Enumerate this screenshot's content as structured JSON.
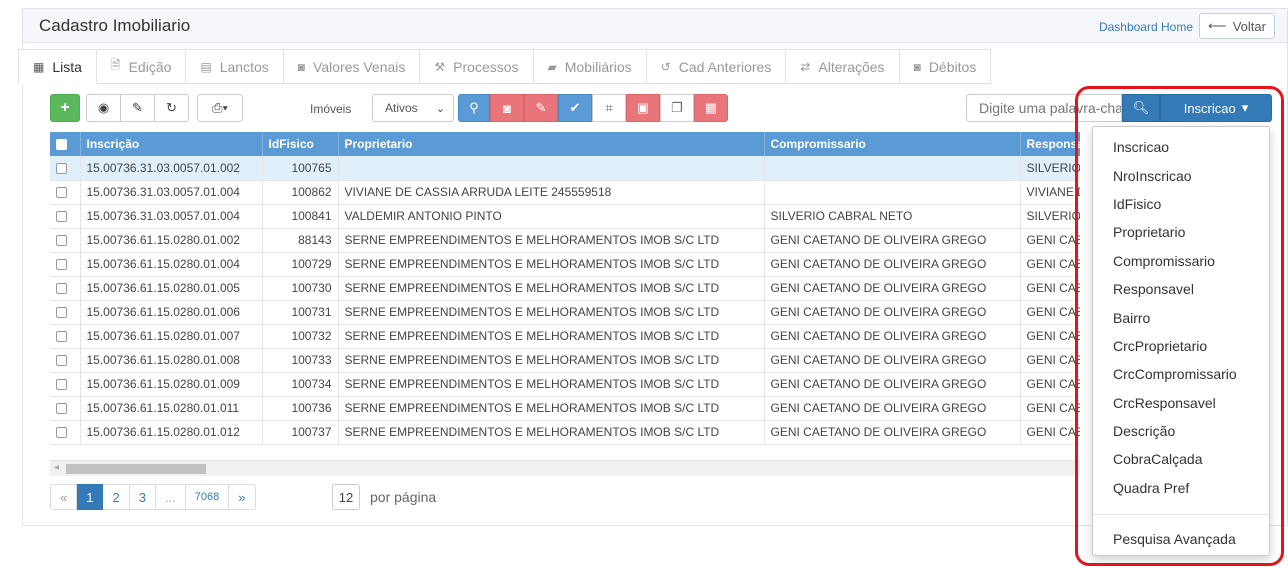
{
  "header": {
    "title": "Cadastro Imobiliario",
    "dashboard_link": "Dashboard Home",
    "back_label": "Voltar",
    "back_icon": "arrow-left-icon"
  },
  "tabs": [
    {
      "label": "Lista",
      "icon": "grid-icon",
      "active": true
    },
    {
      "label": "Edição",
      "icon": "document-icon"
    },
    {
      "label": "Lanctos",
      "icon": "calculator-icon"
    },
    {
      "label": "Valores Venais",
      "icon": "money-icon"
    },
    {
      "label": "Processos",
      "icon": "gavel-icon"
    },
    {
      "label": "Mobiliários",
      "icon": "briefcase-icon"
    },
    {
      "label": "Cad Anteriores",
      "icon": "history-icon"
    },
    {
      "label": "Alterações",
      "icon": "retweet-icon"
    },
    {
      "label": "Débitos",
      "icon": "money-icon"
    }
  ],
  "toolbar": {
    "imoveis_label": "Imóveis",
    "status_select": "Ativos",
    "search_placeholder": "Digite uma palavra-chave",
    "search_field": "Inscricao",
    "colors": {
      "green": "#5cb85c",
      "blue": "#5b9bd5",
      "red": "#e8757a",
      "primary": "#337ab7"
    }
  },
  "table": {
    "columns": [
      "Inscrição",
      "IdFisico",
      "Proprietario",
      "Compromissario",
      "Responsavel"
    ],
    "rows": [
      {
        "inscricao": "15.00736.31.03.0057.01.002",
        "idfisico": "100765",
        "proprietario": "",
        "compromissario": "",
        "responsavel": "SILVERIO CABRAL NETO",
        "selected": true
      },
      {
        "inscricao": "15.00736.31.03.0057.01.004",
        "idfisico": "100862",
        "proprietario": "VIVIANE DE CASSIA ARRUDA LEITE 245559518",
        "compromissario": "",
        "responsavel": "VIVIANE DE CASSIA"
      },
      {
        "inscricao": "15.00736.31.03.0057.01.004",
        "idfisico": "100841",
        "proprietario": "VALDEMIR ANTONIO PINTO",
        "compromissario": "SILVERIO CABRAL NETO",
        "responsavel": "SILVERIO CABRAL NETO"
      },
      {
        "inscricao": "15.00736.61.15.0280.01.002",
        "idfisico": "88143",
        "proprietario": "SERNE EMPREENDIMENTOS E MELHORAMENTOS IMOB S/C LTD",
        "compromissario": "GENI CAETANO DE OLIVEIRA GREGO",
        "responsavel": "GENI CAETANO"
      },
      {
        "inscricao": "15.00736.61.15.0280.01.004",
        "idfisico": "100729",
        "proprietario": "SERNE EMPREENDIMENTOS E MELHORAMENTOS IMOB S/C LTD",
        "compromissario": "GENI CAETANO DE OLIVEIRA GREGO",
        "responsavel": "GENI CAETANO"
      },
      {
        "inscricao": "15.00736.61.15.0280.01.005",
        "idfisico": "100730",
        "proprietario": "SERNE EMPREENDIMENTOS E MELHORAMENTOS IMOB S/C LTD",
        "compromissario": "GENI CAETANO DE OLIVEIRA GREGO",
        "responsavel": "GENI CAETANO"
      },
      {
        "inscricao": "15.00736.61.15.0280.01.006",
        "idfisico": "100731",
        "proprietario": "SERNE EMPREENDIMENTOS E MELHORAMENTOS IMOB S/C LTD",
        "compromissario": "GENI CAETANO DE OLIVEIRA GREGO",
        "responsavel": "GENI CAETANO"
      },
      {
        "inscricao": "15.00736.61.15.0280.01.007",
        "idfisico": "100732",
        "proprietario": "SERNE EMPREENDIMENTOS E MELHORAMENTOS IMOB S/C LTD",
        "compromissario": "GENI CAETANO DE OLIVEIRA GREGO",
        "responsavel": "GENI CAETANO"
      },
      {
        "inscricao": "15.00736.61.15.0280.01.008",
        "idfisico": "100733",
        "proprietario": "SERNE EMPREENDIMENTOS E MELHORAMENTOS IMOB S/C LTD",
        "compromissario": "GENI CAETANO DE OLIVEIRA GREGO",
        "responsavel": "GENI CAETANO"
      },
      {
        "inscricao": "15.00736.61.15.0280.01.009",
        "idfisico": "100734",
        "proprietario": "SERNE EMPREENDIMENTOS E MELHORAMENTOS IMOB S/C LTD",
        "compromissario": "GENI CAETANO DE OLIVEIRA GREGO",
        "responsavel": "GENI CAETANO"
      },
      {
        "inscricao": "15.00736.61.15.0280.01.011",
        "idfisico": "100736",
        "proprietario": "SERNE EMPREENDIMENTOS E MELHORAMENTOS IMOB S/C LTD",
        "compromissario": "GENI CAETANO DE OLIVEIRA GREGO",
        "responsavel": "GENI CAETANO"
      },
      {
        "inscricao": "15.00736.61.15.0280.01.012",
        "idfisico": "100737",
        "proprietario": "SERNE EMPREENDIMENTOS E MELHORAMENTOS IMOB S/C LTD",
        "compromissario": "GENI CAETANO DE OLIVEIRA GREGO",
        "responsavel": "GENI CAETANO"
      }
    ]
  },
  "pagination": {
    "first": "«",
    "pages": [
      "1",
      "2",
      "3",
      "...",
      "7068"
    ],
    "last": "»",
    "current": "1",
    "per_page_value": "12",
    "per_page_label": "por página"
  },
  "dropdown": {
    "items": [
      "Inscricao",
      "NroInscricao",
      "IdFisico",
      "Proprietario",
      "Compromissario",
      "Responsavel",
      "Bairro",
      "CrcProprietario",
      "CrcCompromissario",
      "CrcResponsavel",
      "Descrição",
      "CobraCalçada",
      "Quadra Pref"
    ],
    "advanced": "Pesquisa Avançada",
    "highlight_color": "#e5141b"
  }
}
